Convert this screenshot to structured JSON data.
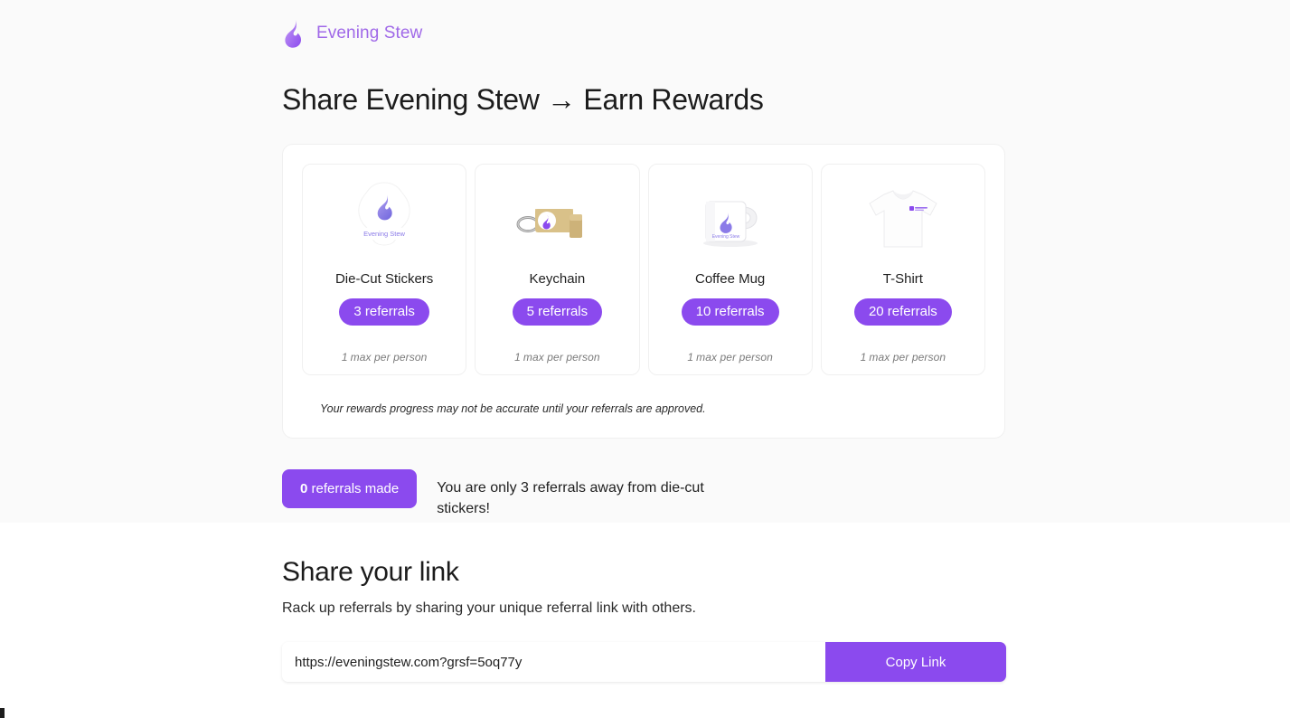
{
  "brand": {
    "name": "Evening Stew",
    "logo_icon": "flame-icon",
    "accent_color": "#8b4aee",
    "brand_text_color": "#a069e8"
  },
  "page": {
    "title": "Share Evening Stew → Earn Rewards"
  },
  "rewards": {
    "note": "Your rewards progress may not be accurate until your referrals are approved.",
    "max_label": "max per person",
    "cards": [
      {
        "title": "Die-Cut Stickers",
        "badge": "3 referrals",
        "max_count": "1",
        "max_text": "max per person",
        "image_icon": "die-cut-sticker-image"
      },
      {
        "title": "Keychain",
        "badge": "5 referrals",
        "max_count": "1",
        "max_text": "max per person",
        "image_icon": "keychain-image"
      },
      {
        "title": "Coffee Mug",
        "badge": "10 referrals",
        "max_count": "1",
        "max_text": "max per person",
        "image_icon": "coffee-mug-image"
      },
      {
        "title": "T-Shirt",
        "badge": "20 referrals",
        "max_count": "1",
        "max_text": "max per person",
        "image_icon": "t-shirt-image"
      }
    ]
  },
  "progress": {
    "count": "0",
    "count_label": "referrals made",
    "message": "You are only 3 referrals away from die-cut stickers!"
  },
  "share": {
    "title": "Share your link",
    "subtitle": "Rack up referrals by sharing your unique referral link with others.",
    "link_value": "https://eveningstew.com?grsf=5oq77y",
    "link_placeholder": "https://eveningstew.com?grsf=5oq77y",
    "copy_button": "Copy Link"
  }
}
